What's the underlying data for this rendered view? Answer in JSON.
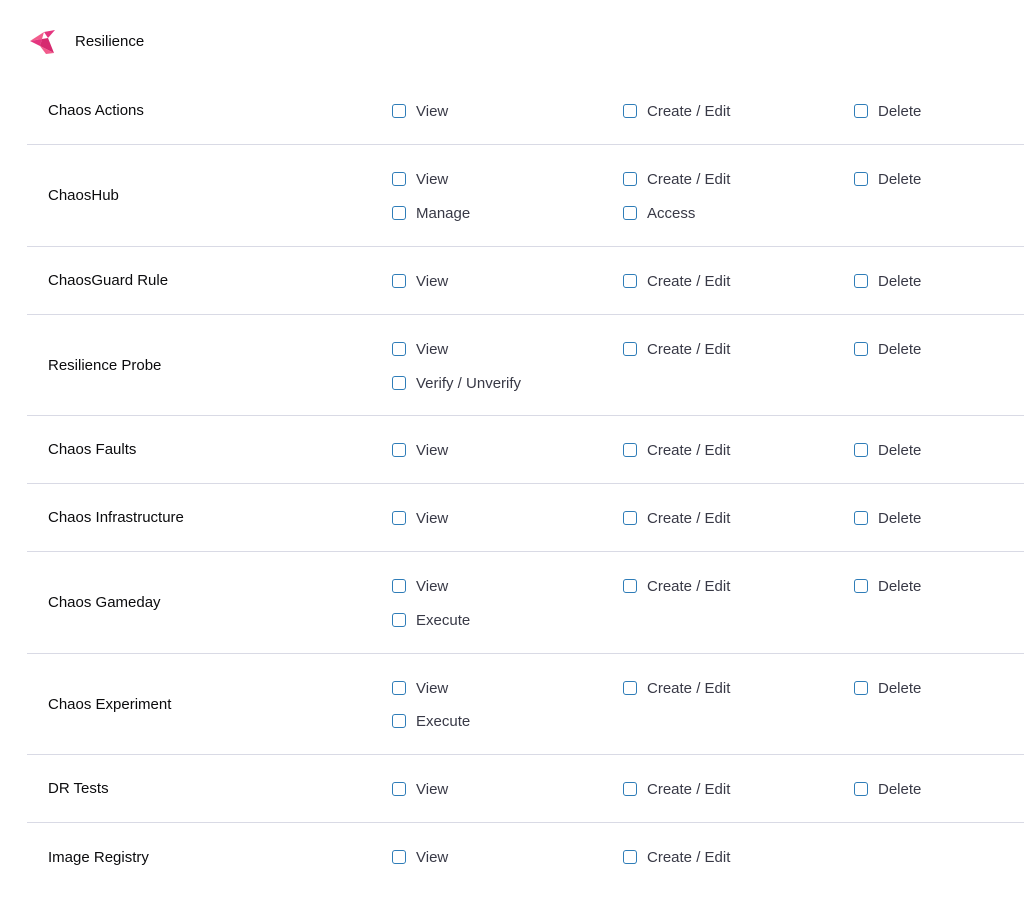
{
  "section": {
    "title": "Resilience",
    "icon": "resilience-logo-icon",
    "brand_colors": [
      "#e4357f",
      "#f25c8c"
    ]
  },
  "colors": {
    "checkbox_border": "#2f7db8",
    "row_divider": "#d9dae5",
    "label_text": "#0b0b0d",
    "permission_text": "#383946"
  },
  "rows": [
    {
      "name": "Chaos Actions",
      "permissions": [
        "View",
        "Create / Edit",
        "Delete"
      ]
    },
    {
      "name": "ChaosHub",
      "permissions": [
        "View",
        "Create / Edit",
        "Delete",
        "Manage",
        "Access"
      ]
    },
    {
      "name": "ChaosGuard Rule",
      "permissions": [
        "View",
        "Create / Edit",
        "Delete"
      ]
    },
    {
      "name": "Resilience Probe",
      "permissions": [
        "View",
        "Create / Edit",
        "Delete",
        "Verify / Unverify"
      ]
    },
    {
      "name": "Chaos Faults",
      "permissions": [
        "View",
        "Create / Edit",
        "Delete"
      ]
    },
    {
      "name": "Chaos Infrastructure",
      "permissions": [
        "View",
        "Create / Edit",
        "Delete"
      ]
    },
    {
      "name": "Chaos Gameday",
      "permissions": [
        "View",
        "Create / Edit",
        "Delete",
        "Execute"
      ]
    },
    {
      "name": "Chaos Experiment",
      "permissions": [
        "View",
        "Create / Edit",
        "Delete",
        "Execute"
      ]
    },
    {
      "name": "DR Tests",
      "permissions": [
        "View",
        "Create / Edit",
        "Delete"
      ]
    },
    {
      "name": "Image Registry",
      "permissions": [
        "View",
        "Create / Edit"
      ]
    }
  ]
}
